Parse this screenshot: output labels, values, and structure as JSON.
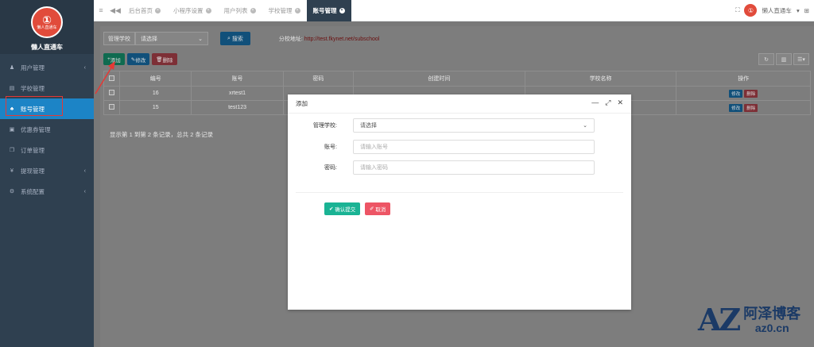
{
  "sidebar": {
    "logo_glyph": "①",
    "logo_text": "懒人直通车",
    "brand_name": "懒人直通车",
    "items": [
      {
        "label": "用户管理",
        "icon": "user-icon",
        "glyph": "♟",
        "has_children": true,
        "active": false
      },
      {
        "label": "学校管理",
        "icon": "document-icon",
        "glyph": "▤",
        "has_children": false,
        "active": false
      },
      {
        "label": "账号管理",
        "icon": "users-icon",
        "glyph": "♣",
        "has_children": false,
        "active": true
      },
      {
        "label": "优惠券管理",
        "icon": "ticket-icon",
        "glyph": "▣",
        "has_children": false,
        "active": false
      },
      {
        "label": "订单管理",
        "icon": "copy-icon",
        "glyph": "❐",
        "has_children": false,
        "active": false
      },
      {
        "label": "提现管理",
        "icon": "yen-icon",
        "glyph": "¥",
        "has_children": true,
        "active": false
      },
      {
        "label": "系统配置",
        "icon": "gear-icon",
        "glyph": "⚙",
        "has_children": true,
        "active": false
      }
    ]
  },
  "topbar": {
    "tabs": [
      {
        "label": "后台首页",
        "active": false
      },
      {
        "label": "小程序设置",
        "active": false
      },
      {
        "label": "用户列表",
        "active": false
      },
      {
        "label": "学校管理",
        "active": false
      },
      {
        "label": "账号管理",
        "active": true
      }
    ],
    "username": "懒人直通车",
    "avatar_glyph": "①"
  },
  "search": {
    "school_label": "管理学校",
    "school_select_value": "请选择",
    "search_button": "搜索",
    "address_label": "分校地址:",
    "address_url": "http://test.fkynet.net/subschool"
  },
  "toolbar": {
    "add": "添加",
    "edit": "修改",
    "delete": "删除"
  },
  "table": {
    "headers": [
      "编号",
      "账号",
      "密码",
      "创建时间",
      "学校名称",
      "操作"
    ],
    "rows": [
      {
        "id": "16",
        "account": "xrtest1"
      },
      {
        "id": "15",
        "account": "test123"
      }
    ],
    "row_edit": "修改",
    "row_delete": "删除",
    "footer": "显示第 1 到第 2 条记录，总共 2 条记录"
  },
  "modal": {
    "title": "添加",
    "school_label": "管理学校:",
    "school_value": "请选择",
    "account_label": "账号:",
    "account_placeholder": "请输入账号",
    "password_label": "密码:",
    "password_placeholder": "请输入密码",
    "confirm": "确认提交",
    "cancel": "取消"
  },
  "watermark": {
    "logo": "AZ",
    "title": "阿泽博客",
    "url": "az0.cn"
  }
}
